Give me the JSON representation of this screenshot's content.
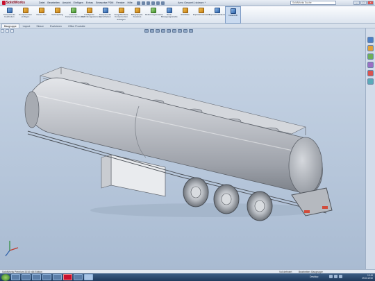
{
  "app": {
    "brand": "SolidWorks",
    "menus": [
      "Datei",
      "Bearbeiten",
      "Ansicht",
      "Einfügen",
      "Extras",
      "Enterprise PDM",
      "Fenster",
      "Hilfe"
    ],
    "document_title": "Aero Gesamt1.sldasm *",
    "search_placeholder": "SolidWorks Suche"
  },
  "ribbon": {
    "buttons": [
      {
        "label": "Komponente bearbeiten",
        "icon": "edit-component-icon"
      },
      {
        "label": "Komponenten einfügen",
        "icon": "insert-components-icon"
      },
      {
        "label": "Neues Teil",
        "icon": "new-part-icon"
      },
      {
        "label": "Verknüpfung",
        "icon": "mate-icon"
      },
      {
        "label": "Linearen Komponentenmuster",
        "icon": "linear-pattern-icon"
      },
      {
        "label": "Intelligente Verbindungselemente",
        "icon": "smart-fasteners-icon"
      },
      {
        "label": "Komponente verschieben",
        "icon": "move-component-icon"
      },
      {
        "label": "Ausgeblendete Komponenten anzeigen",
        "icon": "show-hidden-icon"
      },
      {
        "label": "Baugruppen-Features",
        "icon": "assembly-features-icon"
      },
      {
        "label": "Referenzgeometrie",
        "icon": "reference-geometry-icon"
      },
      {
        "label": "Neue Bewegungsstudie",
        "icon": "motion-study-icon"
      },
      {
        "label": "Stückliste",
        "icon": "bom-icon"
      },
      {
        "label": "Explosionsansicht",
        "icon": "exploded-view-icon"
      },
      {
        "label": "Explosionslinienskizze",
        "icon": "explode-line-icon"
      },
      {
        "label": "Instant3D",
        "icon": "instant3d-icon"
      }
    ]
  },
  "tabs": [
    "Baugruppe",
    "Layout",
    "Skizze",
    "Evaluieren",
    "Office Produkte"
  ],
  "status": {
    "left": "SolidWorks Premium 2010 x64 Edition",
    "center_left": "Voll definiert",
    "center_right": "Bearbeiten: Baugruppe"
  },
  "taskbar": {
    "desktop_label": "Desktop",
    "time": "12:45",
    "date": "29.03.2010"
  },
  "colors": {
    "viewport_top": "#c9d6e6",
    "viewport_bottom": "#a9bbd2",
    "tank": "#b8bcc4",
    "brand": "#c8102e"
  }
}
